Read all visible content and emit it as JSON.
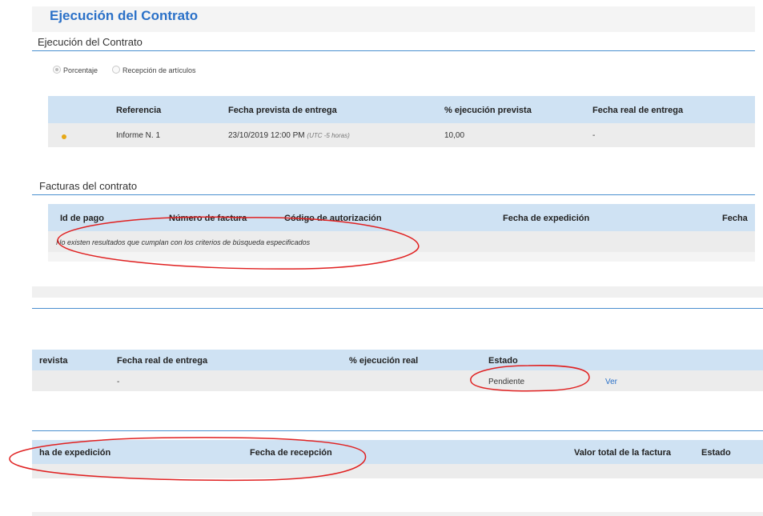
{
  "page": {
    "title": "Ejecución del Contrato"
  },
  "execution": {
    "section_title": "Ejecución del Contrato",
    "radio_options": [
      {
        "label": "Porcentaje",
        "selected": true
      },
      {
        "label": "Recepción de artículos",
        "selected": false
      }
    ],
    "columns": [
      "Referencia",
      "Fecha prevista de entrega",
      "% ejecución prevista",
      "Fecha real de entrega"
    ],
    "rows": [
      {
        "status_color": "#e6a817",
        "reference": "Informe N. 1",
        "due_date": "23/10/2019 12:00 PM",
        "timezone_note": "(UTC -5 horas)",
        "expected_pct": "10,00",
        "actual_date": "-"
      }
    ]
  },
  "invoices": {
    "section_title": "Facturas del contrato",
    "columns": [
      "Id de pago",
      "Número de factura",
      "Código de autorización",
      "Fecha de expedición",
      "Fecha"
    ],
    "empty_message": "No existen resultados que cumplan con los criterios de búsqueda especificados"
  },
  "execution_scrolled": {
    "columns": [
      "revista",
      "Fecha real de entrega",
      "% ejecución real",
      "Estado"
    ],
    "rows": [
      {
        "actual_date": "-",
        "status": "Pendiente",
        "action": "Ver"
      }
    ]
  },
  "invoices_scrolled": {
    "columns": [
      "ha de expedición",
      "Fecha de recepción",
      "Valor total de la factura",
      "Estado"
    ]
  },
  "colors": {
    "accent": "#2b71c8",
    "header_bg": "#cfe2f3",
    "annotation": "#e02020"
  }
}
